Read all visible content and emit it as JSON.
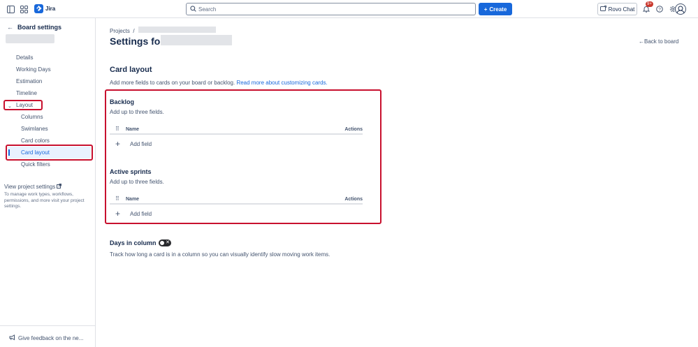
{
  "topbar": {
    "app_name": "Jira",
    "search_placeholder": "Search",
    "create_label": "Create",
    "rovo_label": "Rovo Chat",
    "notifications_badge": "9+"
  },
  "sidebar": {
    "back_title": "Board settings",
    "items": [
      {
        "label": "Details"
      },
      {
        "label": "Working Days"
      },
      {
        "label": "Estimation"
      },
      {
        "label": "Timeline"
      },
      {
        "label": "Layout"
      }
    ],
    "sub_items": [
      {
        "label": "Columns"
      },
      {
        "label": "Swimlanes"
      },
      {
        "label": "Card colors"
      },
      {
        "label": "Card layout"
      },
      {
        "label": "Quick filters"
      }
    ],
    "project_link": "View project settings",
    "project_desc": "To manage work types, workflows, permissions, and more visit your project settings.",
    "feedback": "Give feedback on the ne..."
  },
  "main": {
    "breadcrumb": "Projects",
    "breadcrumb_sep": "/",
    "title_prefix": "Settings for",
    "back_to_board": "Back to board",
    "card_layout": {
      "heading": "Card layout",
      "desc": "Add more fields to cards on your board or backlog.",
      "link": "Read more about customizing cards."
    },
    "groups": [
      {
        "title": "Backlog",
        "subtitle": "Add up to three fields.",
        "col_name": "Name",
        "col_actions": "Actions",
        "add_label": "Add field"
      },
      {
        "title": "Active sprints",
        "subtitle": "Add up to three fields.",
        "col_name": "Name",
        "col_actions": "Actions",
        "add_label": "Add field"
      }
    ],
    "days": {
      "title": "Days in column",
      "desc": "Track how long a card is in a column so you can visually identify slow moving work items.",
      "toggle_on": false
    }
  },
  "colors": {
    "accent": "#1868db",
    "highlight": "#c8102e"
  }
}
